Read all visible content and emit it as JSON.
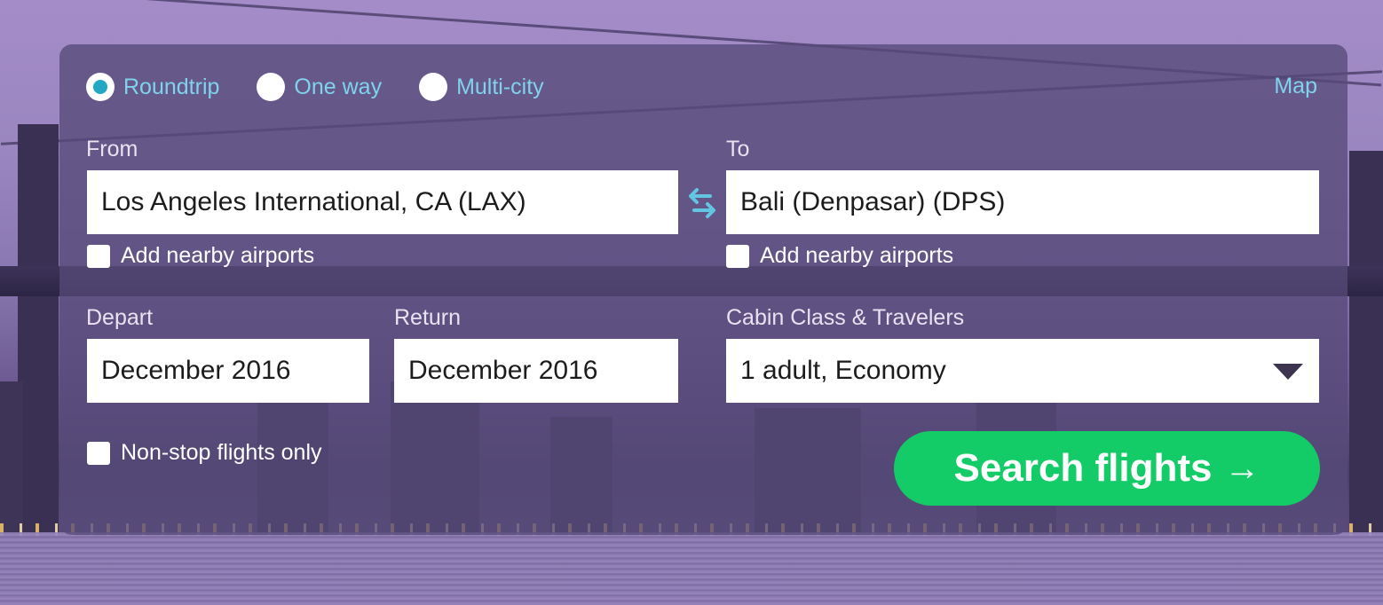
{
  "trip_types": [
    {
      "label": "Roundtrip",
      "checked": true
    },
    {
      "label": "One way",
      "checked": false
    },
    {
      "label": "Multi-city",
      "checked": false
    }
  ],
  "map_link": "Map",
  "from": {
    "label": "From",
    "value": "Los Angeles International, CA (LAX)",
    "nearby_label": "Add nearby airports"
  },
  "to": {
    "label": "To",
    "value": "Bali (Denpasar) (DPS)",
    "nearby_label": "Add nearby airports"
  },
  "depart": {
    "label": "Depart",
    "value": "December 2016"
  },
  "return": {
    "label": "Return",
    "value": "December 2016"
  },
  "cabin": {
    "label": "Cabin Class & Travelers",
    "value": "1 adult, Economy"
  },
  "nonstop_label": "Non-stop flights only",
  "search_button": {
    "label": "Search flights",
    "arrow": "→"
  },
  "colors": {
    "accent_link": "#7fd3ec",
    "radio_checked": "#22a8c3",
    "search_button": "#14cc67",
    "panel": "#564a78"
  },
  "icons": {
    "swap": "swap-arrows-icon",
    "dropdown": "chevron-down-icon",
    "arrow": "arrow-right-icon"
  }
}
